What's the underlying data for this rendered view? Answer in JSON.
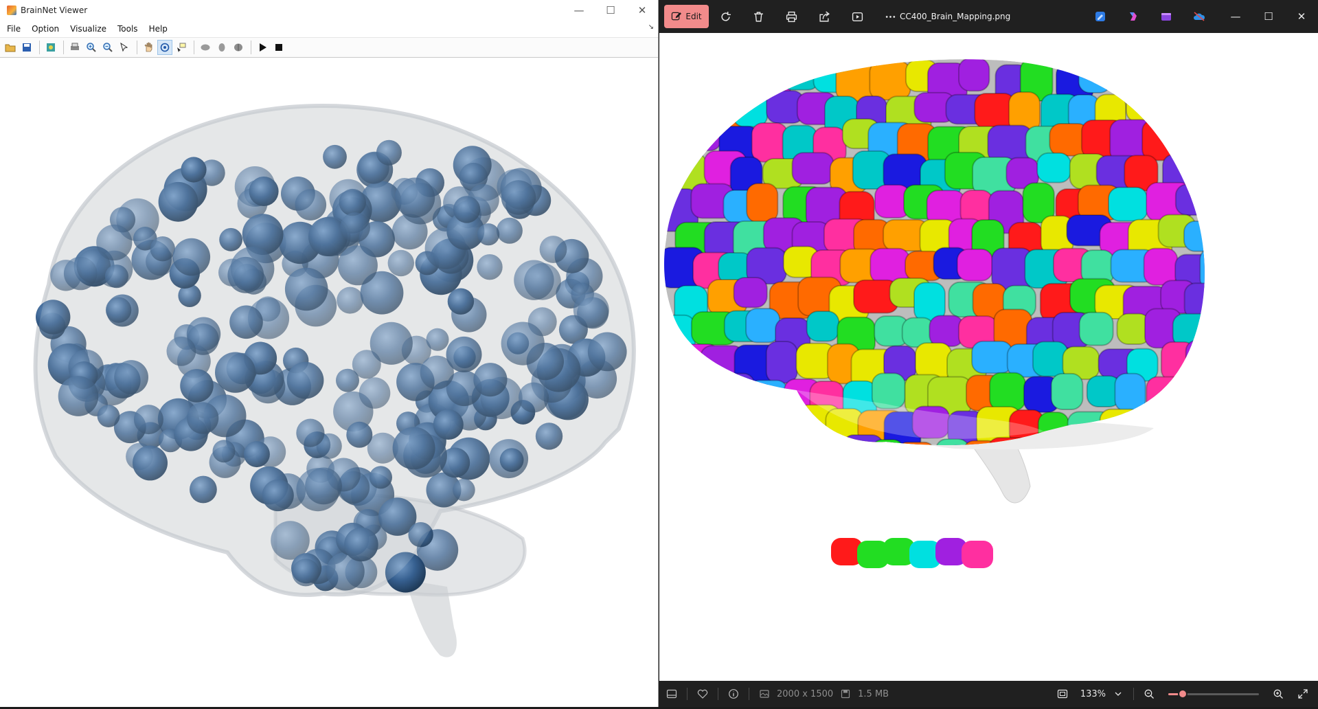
{
  "brainnet": {
    "title": "BrainNet Viewer",
    "window_controls": {
      "minimize": "—",
      "maximize": "☐",
      "close": "✕"
    },
    "menu": [
      "File",
      "Option",
      "Visualize",
      "Tools",
      "Help"
    ],
    "dock_glyph": "↘",
    "toolbar_icons": [
      "open-icon",
      "save-icon",
      "load-icon",
      "print-icon",
      "zoom-in-icon",
      "zoom-out-icon",
      "select-icon",
      "pan-icon",
      "rotate-icon",
      "data-cursor-icon",
      "lateral-view-icon",
      "medial-view-icon",
      "full-view-icon",
      "play-icon",
      "stop-icon"
    ],
    "node_color": "#2f5a8c",
    "surface_color": "#c9cdd1"
  },
  "photos": {
    "edit_label": "Edit",
    "file_name": "CC400_Brain_Mapping.png",
    "toolbar_icons": [
      "rotate-icon",
      "delete-icon",
      "print-icon",
      "share-icon",
      "slideshow-icon",
      "more-icon"
    ],
    "app_icons": [
      "designer-icon",
      "copilot-icon",
      "clipchamp-icon",
      "onedrive-icon"
    ],
    "window_controls": {
      "minimize": "—",
      "maximize": "☐",
      "close": "✕"
    },
    "dimensions": "2000 x 1500",
    "file_size": "1.5 MB",
    "zoom_percent": "133%",
    "zoom_slider_fraction": 0.16,
    "accent": "#f28b8b"
  }
}
